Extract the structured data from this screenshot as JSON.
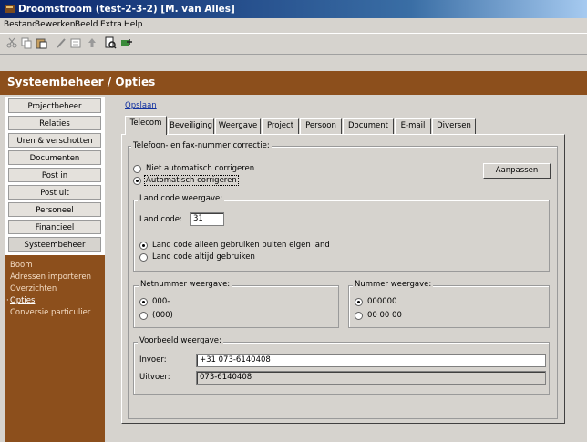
{
  "window": {
    "title": "Droomstroom (test-2-3-2) [M. van Alles]"
  },
  "menu": [
    "Bestand",
    "Bewerken",
    "Beeld",
    "Extra",
    "Help"
  ],
  "header": {
    "title": "Systeembeheer / Opties"
  },
  "sidebar": {
    "items": [
      {
        "label": "Projectbeheer"
      },
      {
        "label": "Relaties"
      },
      {
        "label": "Uren & verschotten"
      },
      {
        "label": "Documenten"
      },
      {
        "label": "Post in"
      },
      {
        "label": "Post uit"
      },
      {
        "label": "Personeel"
      },
      {
        "label": "Financieel"
      },
      {
        "label": "Systeembeheer"
      }
    ],
    "submenu": [
      {
        "label": "Boom"
      },
      {
        "label": "Adressen importeren"
      },
      {
        "label": "Overzichten"
      },
      {
        "label": "Opties",
        "selected": true
      },
      {
        "label": "Conversie particulier"
      }
    ]
  },
  "main": {
    "close_link": "Opslaan",
    "tabs": [
      "Telecom",
      "Beveiliging",
      "Weergave",
      "Project",
      "Persoon",
      "Document",
      "E-mail",
      "Diversen"
    ],
    "active_tab": "Telecom",
    "correction": {
      "title": "Telefoon- en fax-nummer correctie:",
      "option_off": "Niet automatisch corrigeren",
      "option_on": "Automatisch corrigeren",
      "selected": "Automatisch corrigeren",
      "button": "Aanpassen"
    },
    "country": {
      "title": "Land code weergave:",
      "label": "Land code:",
      "value": "31",
      "option_abroad": "Land code alleen gebruiken buiten eigen land",
      "option_always": "Land code altijd gebruiken",
      "selected": "Land code alleen gebruiken buiten eigen land"
    },
    "area": {
      "title": "Netnummer weergave:",
      "opt1": "000-",
      "opt2": "(000)",
      "selected": "000-"
    },
    "number": {
      "title": "Nummer weergave:",
      "opt1": "000000",
      "opt2": "00 00 00",
      "selected": "000000"
    },
    "example": {
      "title": "Voorbeeld weergave:",
      "input_label": "Invoer:",
      "input_value": "+31 073-6140408",
      "output_label": "Uitvoer:",
      "output_value": "073-6140408"
    }
  },
  "colors": {
    "accent": "#8c4f1c",
    "titlebar": "#0a246a",
    "face": "#d6d3ce"
  },
  "icons": [
    "app-icon",
    "cut-icon",
    "copy-icon",
    "paste-icon",
    "edit-icon",
    "properties-icon",
    "up-icon",
    "print-preview-icon",
    "add-icon"
  ]
}
